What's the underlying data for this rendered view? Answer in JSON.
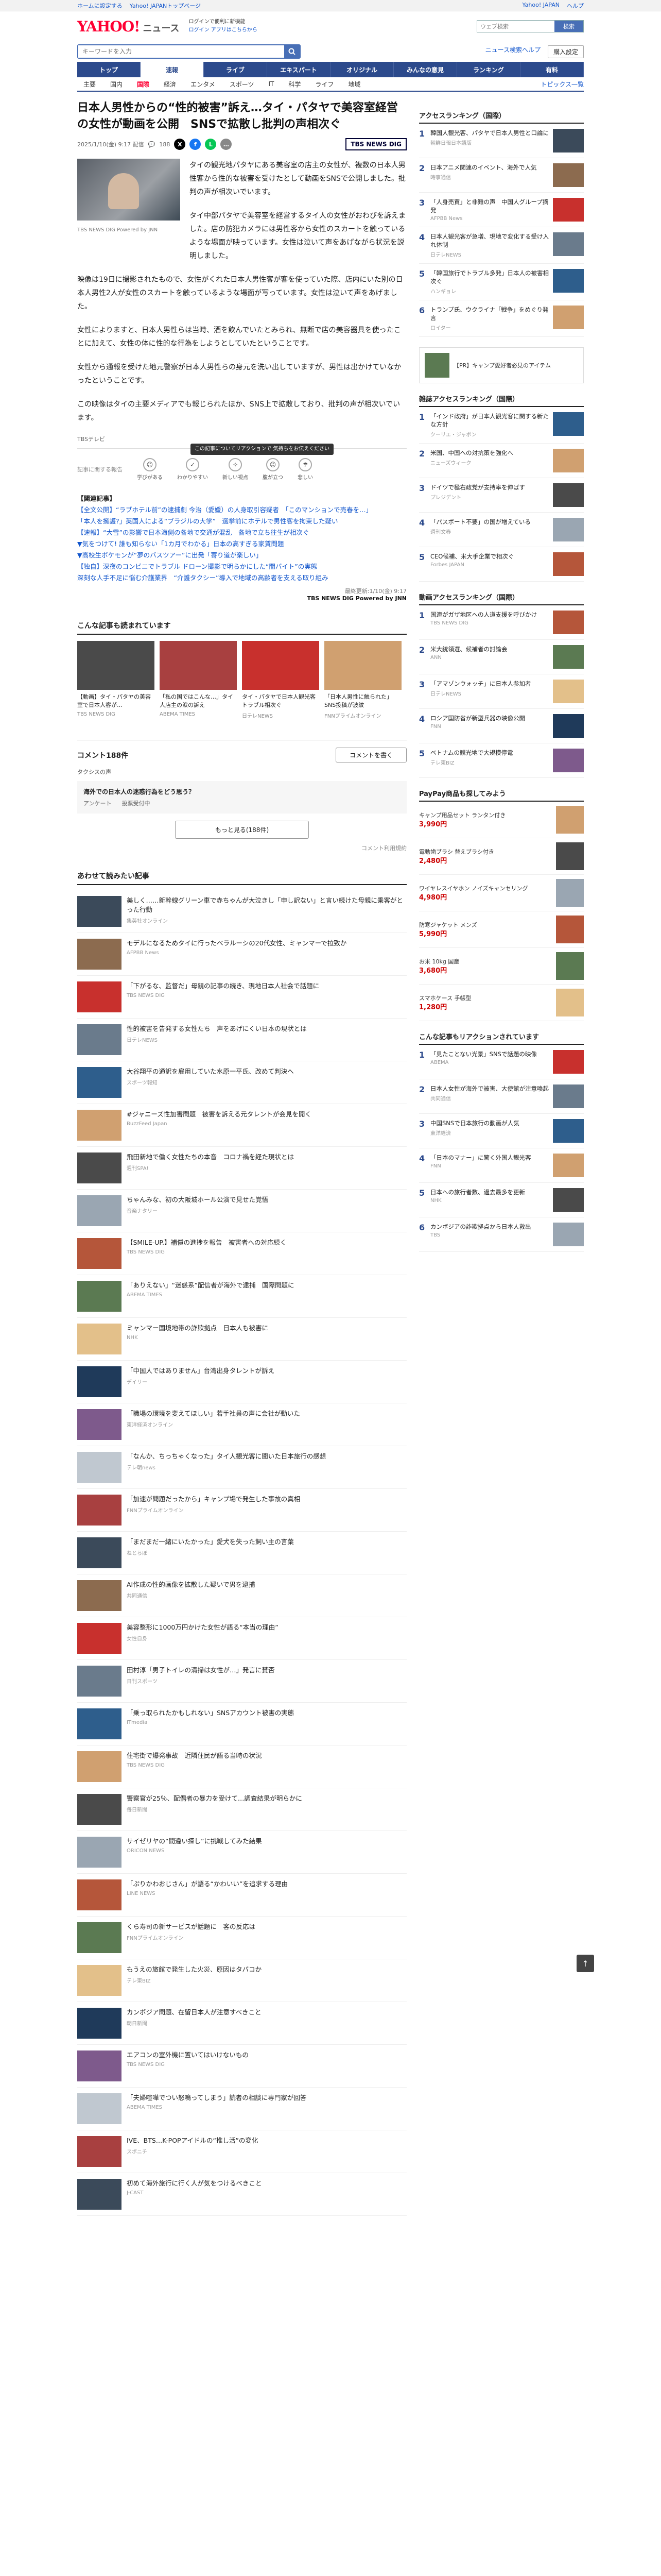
{
  "util": {
    "left": [
      "ホームに設定する",
      "Yahoo! JAPANトップページ"
    ],
    "right": [
      "Yahoo! JAPAN",
      "ヘルプ"
    ]
  },
  "header": {
    "logo_main": "YAHOO!",
    "logo_sub": "JAPAN",
    "logo_news": "ニュース",
    "promo_line1": "ログインで便利に新機能",
    "promo_line2": "ログイン  アプリはこちらから",
    "search_placeholder": "ウェブ検索",
    "search_button": "検索"
  },
  "search": {
    "placeholder": "キーワードを入力",
    "right_links": [
      "ニュース検索ヘルプ"
    ],
    "button": "購入設定"
  },
  "nav": {
    "items": [
      "トップ",
      "速報",
      "ライブ",
      "エキスパート",
      "オリジナル",
      "みんなの意見",
      "ランキング",
      "有料"
    ],
    "active_index": 1
  },
  "subnav": {
    "items": [
      "主要",
      "国内",
      "国際",
      "経済",
      "エンタメ",
      "スポーツ",
      "IT",
      "科学",
      "ライフ",
      "地域"
    ],
    "active_index": 2,
    "topics": "トピックス一覧"
  },
  "article": {
    "title": "日本人男性からの“性的被害”訴え…タイ・パタヤで美容室経営の女性が動画を公開　SNSで拡散し批判の声相次ぐ",
    "date": "2025/1/10(金) 9:17 配信",
    "comments_count": "188",
    "source_logo": "TBS NEWS DIG",
    "lead": "タイの観光地パタヤにある美容室の店主の女性が、複数の日本人男性客から性的な被害を受けたとして動画をSNSで公開しました。批判の声が相次いでいます。",
    "photo_caption": "TBS NEWS DIG Powered by JNN",
    "paragraphs": [
      "タイ中部パタヤで美容室を経営するタイ人の女性がおわびを訴えました。店の防犯カメラには男性客から女性のスカートを触っているような場面が映っています。女性は泣いて声をあげながら状況を説明しました。",
      "映像は19日に撮影されたもので、女性がくれた日本人男性客が客を使っていた際、店内にいた別の日本人男性2人が女性のスカートを触っているような場面が写っています。女性は泣いて声をあげました。",
      "女性によりますと、日本人男性らは当時、酒を飲んでいたとみられ、無断で店の美容器具を使ったことに加えて、女性の体に性的な行為をしようとしていたということです。",
      "女性から通報を受けた地元警察が日本人男性らの身元を洗い出していますが、男性は出かけていなかったということです。",
      "この映像はタイの主要メディアでも報じられたほか、SNS上で拡散しており、批判の声が相次いでいます。"
    ],
    "source_line": "TBSテレビ",
    "reaction_label": "記事に関する報告",
    "reaction_tooltip": "この記事についてリアクションで\n気持ちをお伝えください",
    "reactions": [
      "学びがある",
      "わかりやすい",
      "新しい視点",
      "腹が立つ",
      "悲しい"
    ],
    "related_head": "【関連記事】",
    "related": [
      "【全文公開】“ラブホテル前”の逮捕劇 今治（愛媛）の人身取引容疑者　「このマンションで売春を…」",
      "「本人を擁護?」英国人による“ブラジルの大学”　選挙前にホテルで男性客を拘束した疑い",
      "【速報】“大雪”の影響で日本海側の各地で交通が混乱　各地で立ち往生が相次ぐ",
      "▼気をつけて! 誰も知らない「1カ月でわかる」日本の高すぎる家賃問題",
      "▼高校生ポケモンが“夢のバスツアー”に出発「寄り道が楽しい」",
      "【独自】深夜のコンビニでトラブル ドローン撮影で明らかにした“闇バイト”の実態",
      "深刻な人手不足に悩む介護業界　“介護タクシー”導入で地域の高齢者を支える取り組み"
    ],
    "update": "最終更新:1/10(金) 9:17",
    "credit": "TBS NEWS DIG Powered by JNN"
  },
  "carousel": {
    "title": "こんな記事も読まれています",
    "cards": [
      {
        "t": "【動画】タイ・パタヤの美容室で日本人客が…",
        "s": "TBS NEWS DIG"
      },
      {
        "t": "「私の国ではこんな…」タイ人店主の涙の訴え",
        "s": "ABEMA TIMES"
      },
      {
        "t": "タイ・パタヤで日本人観光客トラブル相次ぐ",
        "s": "日テレNEWS"
      },
      {
        "t": "「日本人男性に触られた」SNS投稿が波紋",
        "s": "FNNプライムオンライン"
      }
    ]
  },
  "comments": {
    "title": "コメント188件",
    "button": "コメントを書く",
    "sub": "タクシスの声",
    "card_q": "海外での日本人の迷惑行為をどう思う？",
    "card_row": [
      "アンケート",
      "投票受付中"
    ],
    "more": "もっと見る(188件)",
    "policy": "コメント利用規約"
  },
  "feed": {
    "title": "あわせて読みたい記事",
    "items": [
      {
        "t": "美しく……新幹線グリーン車で赤ちゃんが大泣きし「申し訳ない」と言い続けた母親に乗客がとった行動",
        "s": "集英社オンライン"
      },
      {
        "t": "モデルになるためタイに行ったベラルーシの20代女性、ミャンマーで拉致か",
        "s": "AFPBB News"
      },
      {
        "t": "「下がるな、監督だ」母親の記事の続き、現地日本人社会で話題に",
        "s": "TBS NEWS DIG"
      },
      {
        "t": "性的被害を告発する女性たち　声をあげにくい日本の現状とは",
        "s": "日テレNEWS"
      },
      {
        "t": "大谷翔平の通訳を雇用していた水原一平氏、改めて判決へ",
        "s": "スポーツ報知"
      },
      {
        "t": "#ジャニーズ性加害問題　被害を訴える元タレントが会見を開く",
        "s": "BuzzFeed Japan"
      },
      {
        "t": "飛田新地で働く女性たちの本音　コロナ禍を経た現状とは",
        "s": "週刊SPA!"
      },
      {
        "t": "ちゃんみな、初の大阪城ホール公演で見せた覚悟",
        "s": "音楽ナタリー"
      },
      {
        "t": "【SMILE-UP.】補償の進捗を報告　被害者への対応続く",
        "s": "TBS NEWS DIG"
      },
      {
        "t": "「ありえない」“迷惑系”配信者が海外で逮捕　国際問題に",
        "s": "ABEMA TIMES"
      },
      {
        "t": "ミャンマー国境地帯の詐欺拠点　日本人も被害に",
        "s": "NHK"
      },
      {
        "t": "「中国人ではありません」台湾出身タレントが訴え",
        "s": "デイリー"
      },
      {
        "t": "「職場の環境を変えてほしい」若手社員の声に会社が動いた",
        "s": "東洋経済オンライン"
      },
      {
        "t": "「なんか、ちっちゃくなった」タイ人観光客に聞いた日本旅行の感想",
        "s": "テレ朝news"
      },
      {
        "t": "「加速が問題だったから」キャンプ場で発生した事故の真相",
        "s": "FNNプライムオンライン"
      },
      {
        "t": "「まだまだ一緒にいたかった」愛犬を失った飼い主の言葉",
        "s": "ねとらぼ"
      },
      {
        "t": "AI作成の性的画像を拡散した疑いで男を逮捕",
        "s": "共同通信"
      },
      {
        "t": "美容整形に1000万円かけた女性が語る“本当の理由”",
        "s": "女性自身"
      },
      {
        "t": "田村淳「男子トイレの清掃は女性が…」発言に賛否",
        "s": "日刊スポーツ"
      },
      {
        "t": "「乗っ取られたかもしれない」SNSアカウント被害の実態",
        "s": "ITmedia"
      },
      {
        "t": "住宅街で爆発事故　近隣住民が語る当時の状況",
        "s": "TBS NEWS DIG"
      },
      {
        "t": "警察官が25％、配偶者の暴力を受けて…調査結果が明らかに",
        "s": "毎日新聞"
      },
      {
        "t": "サイゼリヤの“間違い探し”に挑戦してみた結果",
        "s": "ORICON NEWS"
      },
      {
        "t": "「ぷりかわおじさん」が語る“かわいい”を追求する理由",
        "s": "LINE NEWS"
      },
      {
        "t": "くら寿司の新サービスが話題に　客の反応は",
        "s": "FNNプライムオンライン"
      },
      {
        "t": "もうえの旅館で発生した火災、原因はタバコか",
        "s": "テレ東BIZ"
      },
      {
        "t": "カンボジア問題、在留日本人が注意すべきこと",
        "s": "朝日新聞"
      },
      {
        "t": "エアコンの室外機に置いてはいけないもの",
        "s": "TBS NEWS DIG"
      },
      {
        "t": "「夫婦喧嘩でつい怒鳴ってしまう」読者の相談に専門家が回答",
        "s": "ABEMA TIMES"
      },
      {
        "t": "IVE、BTS…K-POPアイドルの“推し活”の変化",
        "s": "スポニチ"
      },
      {
        "t": "初めて海外旅行に行く人が気をつけるべきこと",
        "s": "J-CAST"
      }
    ]
  },
  "sidebar": {
    "access_title": "アクセスランキング（国際）",
    "access": [
      {
        "t": "韓国人観光客、パタヤで日本人男性と口論に",
        "s": "朝鮮日報日本語版"
      },
      {
        "t": "日本アニメ関連のイベント、海外で人気",
        "s": "時事通信"
      },
      {
        "t": "「人身売買」と非難の声　中国人グループ摘発",
        "s": "AFPBB News"
      },
      {
        "t": "日本人観光客が急増、現地で変化する受け入れ体制",
        "s": "日テレNEWS"
      },
      {
        "t": "「韓国旅行でトラブル多発」日本人の被害相次ぐ",
        "s": "ハンギョレ"
      },
      {
        "t": "トランプ氏、ウクライナ「戦争」をめぐり発言",
        "s": "ロイター"
      }
    ],
    "ad": "【PR】キャンプ愛好者必見のアイテム",
    "comment_title": "雑誌アクセスランキング（国際）",
    "comment": [
      {
        "t": "「インド政府」が日本人観光客に関する新たな方針",
        "s": "クーリエ・ジャポン"
      },
      {
        "t": "米国、中国への対抗策を強化へ",
        "s": "ニューズウィーク"
      },
      {
        "t": "ドイツで極右政党が支持率を伸ばす",
        "s": "プレジデント"
      },
      {
        "t": "「パスポート不要」の国が増えている",
        "s": "週刊文春"
      },
      {
        "t": "CEO候補、米大手企業で相次ぐ",
        "s": "Forbes JAPAN"
      }
    ],
    "news_title": "動画アクセスランキング（国際）",
    "news": [
      {
        "t": "国連がガザ地区への人道支援を呼びかけ",
        "s": "TBS NEWS DIG"
      },
      {
        "t": "米大統領選、候補者の討論会",
        "s": "ANN"
      },
      {
        "t": "「アマゾンウォッチ」に日本人参加者",
        "s": "日テレNEWS"
      },
      {
        "t": "ロシア国防省が新型兵器の映像公開",
        "s": "FNN"
      },
      {
        "t": "ベトナムの観光地で大規模停電",
        "s": "テレ東BIZ"
      }
    ],
    "shop_title": "PayPay商品も探してみよう",
    "shop": [
      {
        "t": "キャンプ用品セット ランタン付き",
        "p": "3,990円"
      },
      {
        "t": "電動歯ブラシ 替えブラシ付き",
        "p": "2,480円"
      },
      {
        "t": "ワイヤレスイヤホン ノイズキャンセリング",
        "p": "4,980円"
      },
      {
        "t": "防寒ジャケット メンズ",
        "p": "5,990円"
      },
      {
        "t": "お米 10kg 国産",
        "p": "3,680円"
      },
      {
        "t": "スマホケース 手帳型",
        "p": "1,280円"
      }
    ],
    "topics_title": "こんな記事もリアクションされています",
    "topics": [
      {
        "t": "「見たことない光景」SNSで話題の映像",
        "s": "ABEMA"
      },
      {
        "t": "日本人女性が海外で被害、大使館が注意喚起",
        "s": "共同通信"
      },
      {
        "t": "中国SNSで日本旅行の動画が人気",
        "s": "東洋経済"
      },
      {
        "t": "「日本のマナー」に驚く外国人観光客",
        "s": "FNN"
      },
      {
        "t": "日本への旅行者数、過去最多を更新",
        "s": "NHK"
      },
      {
        "t": "カンボジアの詐欺拠点から日本人救出",
        "s": "TBS"
      }
    ]
  },
  "to_top": "↑"
}
